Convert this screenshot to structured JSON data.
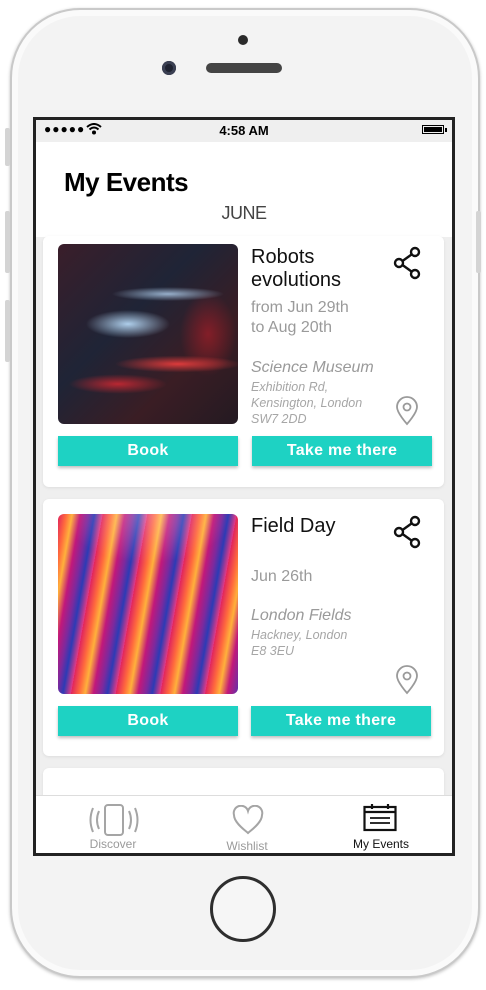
{
  "status_bar": {
    "signal": "●●●●●",
    "time": "4:58 AM"
  },
  "header": {
    "title": "My Events",
    "month": "JUNE"
  },
  "events": [
    {
      "title_line1": "Robots",
      "title_line2": "evolutions",
      "date_line1": "from Jun 29th",
      "date_line2": "to Aug 20th",
      "venue": "Science Museum",
      "address_line1": "Exhibition Rd,",
      "address_line2": "Kensington, London",
      "address_line3": "SW7 2DD",
      "book_label": "Book",
      "directions_label": "Take me there"
    },
    {
      "title_line1": "Field Day",
      "date_line1": "Jun 26th",
      "venue": "London Fields",
      "address_line1": "Hackney, London",
      "address_line2": "E8 3EU",
      "book_label": "Book",
      "directions_label": "Take me there"
    }
  ],
  "tab_bar": {
    "tabs": [
      {
        "label": "Discover",
        "icon": "phone-vibrate-icon"
      },
      {
        "label": "Wishlist",
        "icon": "heart-icon"
      },
      {
        "label": "My Events",
        "icon": "calendar-list-icon",
        "active": true
      }
    ]
  },
  "colors": {
    "accent": "#1ed2c3",
    "screen_bg": "#efefef"
  }
}
